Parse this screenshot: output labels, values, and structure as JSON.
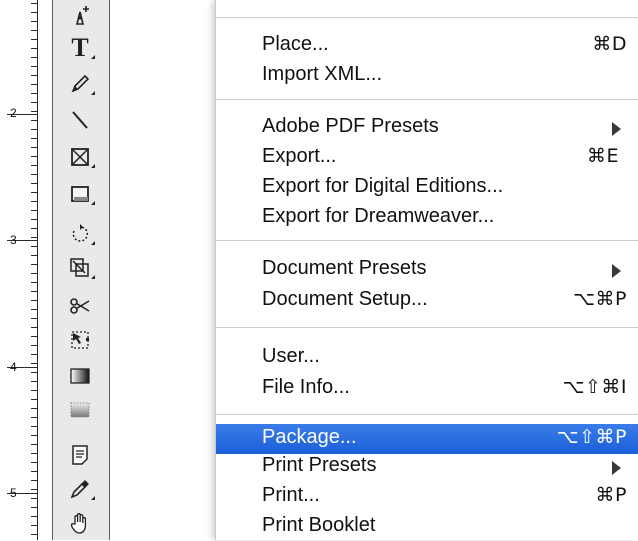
{
  "ruler": {
    "labels": [
      "2",
      "3",
      "4",
      "5"
    ]
  },
  "menu": {
    "items": [
      {
        "label": "Place...",
        "shortcut": "⌘D"
      },
      {
        "label": "Import XML...",
        "shortcut": ""
      },
      {
        "label": "Adobe PDF Presets",
        "shortcut": "",
        "submenu": true
      },
      {
        "label": "Export...",
        "shortcut": "⌘E"
      },
      {
        "label": "Export for Digital Editions...",
        "shortcut": ""
      },
      {
        "label": "Export for Dreamweaver...",
        "shortcut": ""
      },
      {
        "label": "Document Presets",
        "shortcut": "",
        "submenu": true
      },
      {
        "label": "Document Setup...",
        "shortcut": "⌥⌘P"
      },
      {
        "label": "User...",
        "shortcut": ""
      },
      {
        "label": "File Info...",
        "shortcut": "⌥⇧⌘I"
      },
      {
        "label": "Package...",
        "shortcut": "⌥⇧⌘P",
        "highlighted": true
      },
      {
        "label": "Print Presets",
        "shortcut": "",
        "submenu": true
      },
      {
        "label": "Print...",
        "shortcut": "⌘P"
      },
      {
        "label": "Print Booklet",
        "shortcut": ""
      }
    ]
  },
  "tools": [
    {
      "icon": "add-anchor-point-icon"
    },
    {
      "icon": "type-tool-icon",
      "glyph": "T"
    },
    {
      "icon": "pencil-icon"
    },
    {
      "icon": "line-tool-icon"
    },
    {
      "icon": "rectangle-frame-icon"
    },
    {
      "icon": "rectangle-icon"
    },
    {
      "icon": "rotate-icon"
    },
    {
      "icon": "scale-icon"
    },
    {
      "icon": "scissors-icon"
    },
    {
      "icon": "free-transform-icon"
    },
    {
      "icon": "gradient-icon"
    },
    {
      "icon": "gradient-feather-icon"
    },
    {
      "icon": "note-icon"
    },
    {
      "icon": "eyedropper-icon"
    },
    {
      "icon": "hand-icon"
    }
  ],
  "colors": {
    "highlight": "#1b5fd8",
    "panel": "#e9e9e9"
  }
}
